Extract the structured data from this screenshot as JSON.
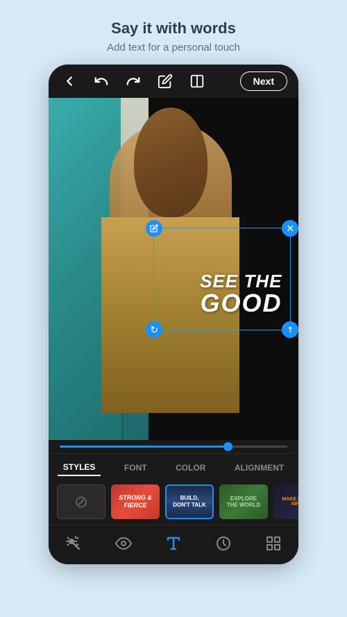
{
  "header": {
    "title": "Say it with words",
    "subtitle": "Add text for a personal touch"
  },
  "topbar": {
    "next_label": "Next"
  },
  "text_overlay": {
    "line1": "SEE THE",
    "line2": "GOOD"
  },
  "tabs": [
    {
      "id": "styles",
      "label": "STYLES",
      "active": true
    },
    {
      "id": "font",
      "label": "FONT",
      "active": false
    },
    {
      "id": "color",
      "label": "COLOR",
      "active": false
    },
    {
      "id": "alignment",
      "label": "ALIGNMENT",
      "active": false
    }
  ],
  "style_thumbs": [
    {
      "id": "none",
      "type": "none"
    },
    {
      "id": "strong-fierce",
      "type": "red",
      "line1": "STRONG &",
      "line2": "FIERCE"
    },
    {
      "id": "build-dont-talk",
      "type": "blue",
      "line1": "BUILD,",
      "line2": "DON'T TALK",
      "selected": true
    },
    {
      "id": "explore-the-world",
      "type": "green",
      "line1": "EXPLORE",
      "line2": "THE WORLD"
    },
    {
      "id": "make-it-signif",
      "type": "dark",
      "line1": "MAKE IT SIG-",
      "line2": "NIFIC"
    }
  ],
  "bottom_nav": {
    "items": [
      {
        "id": "wand",
        "active": false
      },
      {
        "id": "eye",
        "active": false
      },
      {
        "id": "text",
        "active": true
      },
      {
        "id": "clock",
        "active": false
      },
      {
        "id": "layers",
        "active": false
      }
    ]
  }
}
